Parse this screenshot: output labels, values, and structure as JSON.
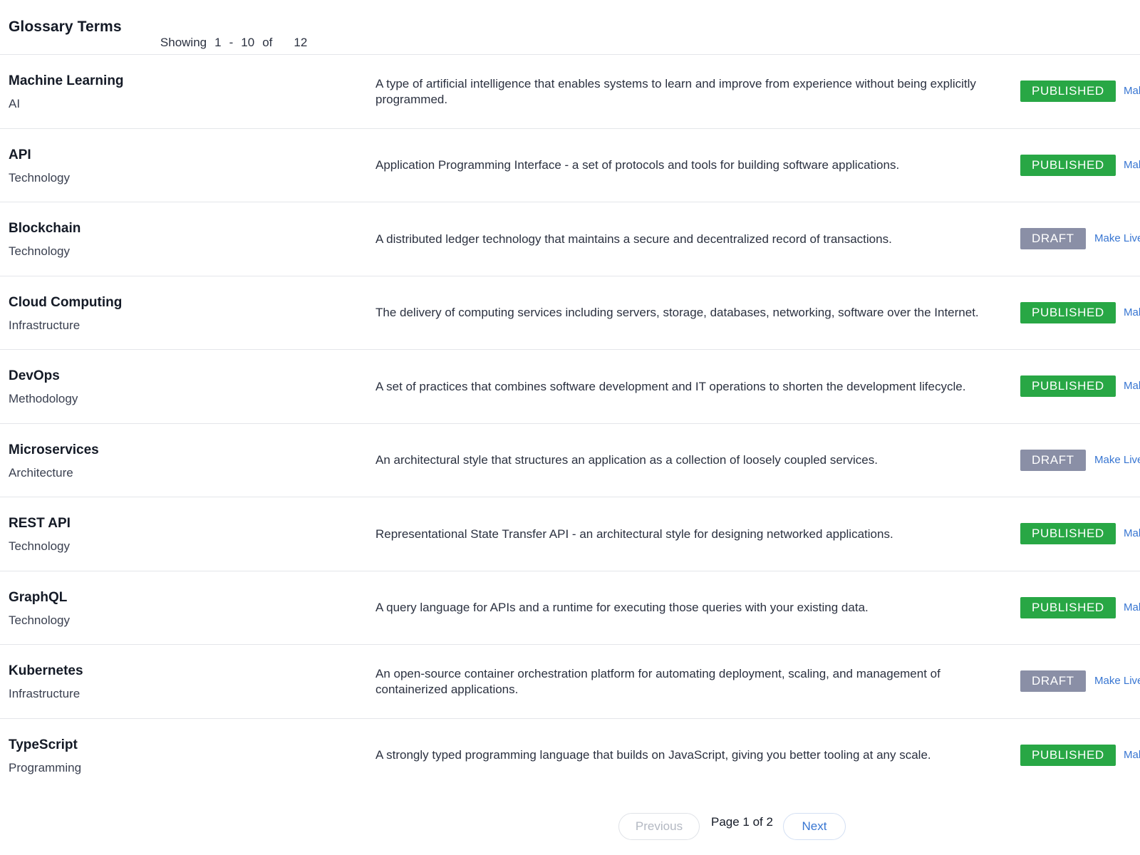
{
  "header": {
    "title": "Glossary Terms",
    "showing_label": "Showing",
    "range_start": "1",
    "range_sep": "-",
    "range_end": "10",
    "of_label": "of",
    "total": "12"
  },
  "colors": {
    "published": "#28a745",
    "draft": "#8a8fa6",
    "link": "#3876d2"
  },
  "terms": [
    {
      "name": "Machine Learning",
      "category": "AI",
      "description": "A type of artificial intelligence that enables systems to learn and improve from experience without being explicitly programmed.",
      "status": "PUBLISHED",
      "action": "Mak"
    },
    {
      "name": "API",
      "category": "Technology",
      "description": "Application Programming Interface - a set of protocols and tools for building software applications.",
      "status": "PUBLISHED",
      "action": "Mak"
    },
    {
      "name": "Blockchain",
      "category": "Technology",
      "description": "A distributed ledger technology that maintains a secure and decentralized record of transactions.",
      "status": "DRAFT",
      "action": "Make Live"
    },
    {
      "name": "Cloud Computing",
      "category": "Infrastructure",
      "description": "The delivery of computing services including servers, storage, databases, networking, software over the Internet.",
      "status": "PUBLISHED",
      "action": "Mak"
    },
    {
      "name": "DevOps",
      "category": "Methodology",
      "description": "A set of practices that combines software development and IT operations to shorten the development lifecycle.",
      "status": "PUBLISHED",
      "action": "Mak"
    },
    {
      "name": "Microservices",
      "category": "Architecture",
      "description": "An architectural style that structures an application as a collection of loosely coupled services.",
      "status": "DRAFT",
      "action": "Make Live"
    },
    {
      "name": "REST API",
      "category": "Technology",
      "description": "Representational State Transfer API - an architectural style for designing networked applications.",
      "status": "PUBLISHED",
      "action": "Mak"
    },
    {
      "name": "GraphQL",
      "category": "Technology",
      "description": "A query language for APIs and a runtime for executing those queries with your existing data.",
      "status": "PUBLISHED",
      "action": "Mak"
    },
    {
      "name": "Kubernetes",
      "category": "Infrastructure",
      "description": "An open-source container orchestration platform for automating deployment, scaling, and management of containerized applications.",
      "status": "DRAFT",
      "action": "Make Live"
    },
    {
      "name": "TypeScript",
      "category": "Programming",
      "description": "A strongly typed programming language that builds on JavaScript, giving you better tooling at any scale.",
      "status": "PUBLISHED",
      "action": "Mak"
    }
  ],
  "pagination": {
    "previous_label": "Previous",
    "page_info": "Page 1 of 2",
    "next_label": "Next"
  }
}
